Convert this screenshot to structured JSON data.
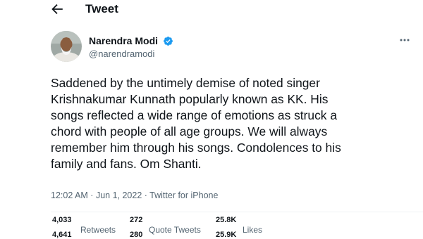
{
  "header": {
    "title": "Tweet"
  },
  "author": {
    "display_name": "Narendra Modi",
    "handle": "@narendramodi",
    "verified": true
  },
  "tweet": {
    "lines": [
      "Saddened by the untimely demise of noted singer",
      "Krishnakumar Kunnath popularly known as KK. His",
      "songs reflected a wide range of emotions as struck a",
      "chord with people of all age groups. We will always",
      "remember him through his songs. Condolences to his",
      "family and fans. Om Shanti."
    ]
  },
  "meta": {
    "time": "12:02 AM",
    "separator": " · ",
    "date": "Jun 1, 2022",
    "source": "Twitter for iPhone"
  },
  "stats": {
    "retweets": {
      "count_old": "4,033",
      "count_new": "4,641",
      "label": "Retweets"
    },
    "quote_tweets": {
      "count_old": "272",
      "count_new": "280",
      "label": "Quote Tweets"
    },
    "likes": {
      "count_old": "25.8K",
      "count_new": "25.9K",
      "label": "Likes"
    }
  },
  "colors": {
    "verified": "#1d9bf0",
    "secondary_text": "#536471",
    "primary_text": "#0f1419"
  }
}
